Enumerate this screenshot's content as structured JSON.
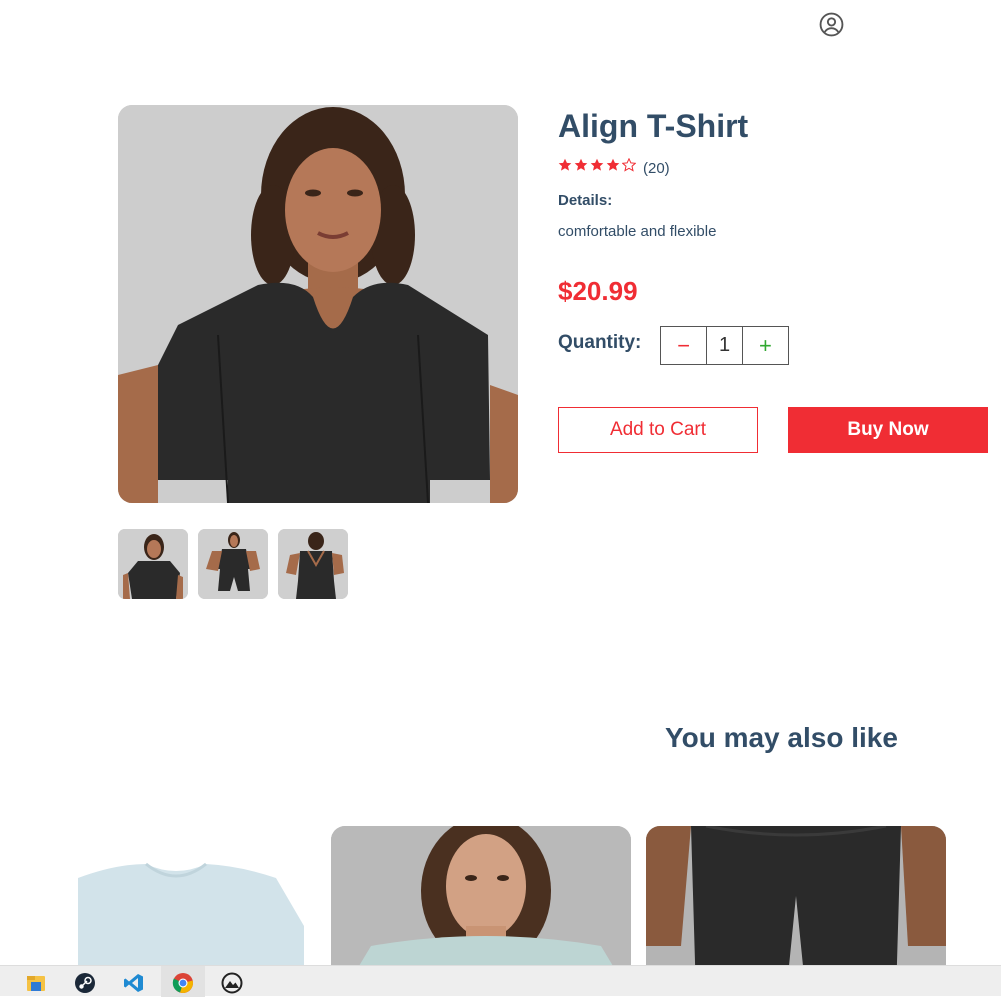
{
  "product": {
    "title": "Align T-Shirt",
    "rating": 4,
    "rating_max": 5,
    "review_count": "(20)",
    "details_label": "Details:",
    "details_text": "comfortable and flexible",
    "price": "$20.99",
    "quantity_label": "Quantity:",
    "quantity_value": "1",
    "minus_symbol": "−",
    "plus_symbol": "+",
    "add_to_cart_label": "Add to Cart",
    "buy_now_label": "Buy Now"
  },
  "recommendations": {
    "title": "You may also like"
  },
  "colors": {
    "accent": "#f02d34",
    "text": "#324d67",
    "plus": "#31a831"
  },
  "icons": {
    "header": "user-circle-icon",
    "taskbar": [
      "file-explorer-icon",
      "steam-icon",
      "vscode-icon",
      "chrome-icon",
      "photos-icon"
    ]
  }
}
